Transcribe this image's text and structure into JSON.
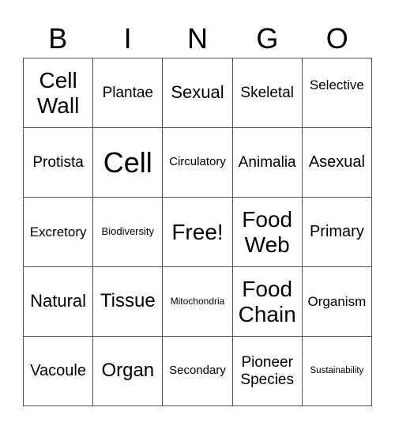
{
  "header": {
    "letters": [
      "B",
      "I",
      "N",
      "G",
      "O"
    ]
  },
  "board": {
    "rows": [
      [
        "Cell Wall",
        "Plantae",
        "Sexual",
        "Skeletal",
        "Selective"
      ],
      [
        "Protista",
        "Cell",
        "Circulatory",
        "Animalia",
        "Asexual"
      ],
      [
        "Excretory",
        "Biodiversity",
        "Free!",
        "Food Web",
        "Primary"
      ],
      [
        "Natural",
        "Tissue",
        "Mitochondria",
        "Food Chain",
        "Organism"
      ],
      [
        "Vacoule",
        "Organ",
        "Secondary",
        "Pioneer Species",
        "Sustainability"
      ]
    ],
    "free_space": "Free!"
  }
}
